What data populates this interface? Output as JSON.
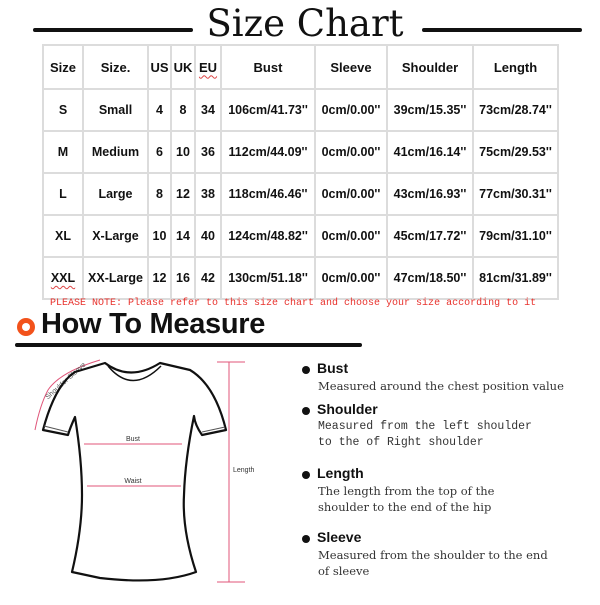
{
  "header": {
    "title": "Size Chart"
  },
  "size_table": {
    "columns": [
      "Size",
      "Size.",
      "US",
      "UK",
      "EU",
      "Bust",
      "Sleeve",
      "Shoulder",
      "Length"
    ],
    "rows": [
      [
        "S",
        "Small",
        "4",
        "8",
        "34",
        "106cm/41.73''",
        "0cm/0.00''",
        "39cm/15.35''",
        "73cm/28.74''"
      ],
      [
        "M",
        "Medium",
        "6",
        "10",
        "36",
        "112cm/44.09''",
        "0cm/0.00''",
        "41cm/16.14''",
        "75cm/29.53''"
      ],
      [
        "L",
        "Large",
        "8",
        "12",
        "38",
        "118cm/46.46''",
        "0cm/0.00''",
        "43cm/16.93''",
        "77cm/30.31''"
      ],
      [
        "XL",
        "X-Large",
        "10",
        "14",
        "40",
        "124cm/48.82''",
        "0cm/0.00''",
        "45cm/17.72''",
        "79cm/31.10''"
      ],
      [
        "XXL",
        "XX-Large",
        "12",
        "16",
        "42",
        "130cm/51.18''",
        "0cm/0.00''",
        "47cm/18.50''",
        "81cm/31.89''"
      ]
    ]
  },
  "note": "PLEASE NOTE: Please refer to this size chart and choose your size according to it",
  "how_to_measure": {
    "title": "How To Measure",
    "diagram_labels": {
      "shoulder_sleeve": "Shoulder Sleeve",
      "bust": "Bust",
      "waist": "Waist",
      "length": "Length"
    },
    "items": [
      {
        "name": "Bust",
        "desc": "Measured around the chest position value"
      },
      {
        "name": "Shoulder",
        "desc": "Measured from the left shoulder to the of Right shoulder"
      },
      {
        "name": "Length",
        "desc": "The length from the top of the shoulder to the end of the hip"
      },
      {
        "name": "Sleeve",
        "desc": "Measured from the shoulder to the end of sleeve"
      }
    ]
  },
  "colors": {
    "accent_orange": "#f2521b",
    "note_red": "#e8312c",
    "measure_pink": "#e0567a"
  }
}
